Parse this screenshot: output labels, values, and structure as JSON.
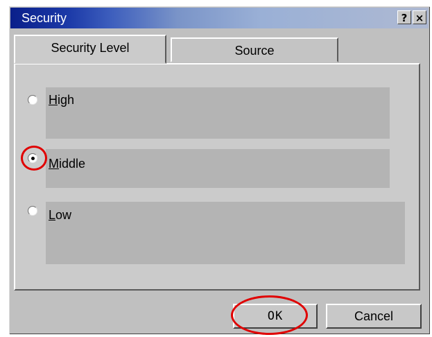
{
  "window": {
    "title": "Security"
  },
  "title_buttons": {
    "help": "?",
    "close": "×"
  },
  "tabs": [
    {
      "label": "Security Level",
      "active": true
    },
    {
      "label": "Source",
      "active": false
    }
  ],
  "options": [
    {
      "mnemonic": "H",
      "rest": "igh",
      "selected": false
    },
    {
      "mnemonic": "M",
      "rest": "iddle",
      "selected": true
    },
    {
      "mnemonic": "L",
      "rest": "ow",
      "selected": false
    }
  ],
  "buttons": {
    "ok": "OK",
    "cancel": "Cancel"
  },
  "colors": {
    "highlight": "#e00000",
    "titlebar_start": "#0a1f8a"
  }
}
